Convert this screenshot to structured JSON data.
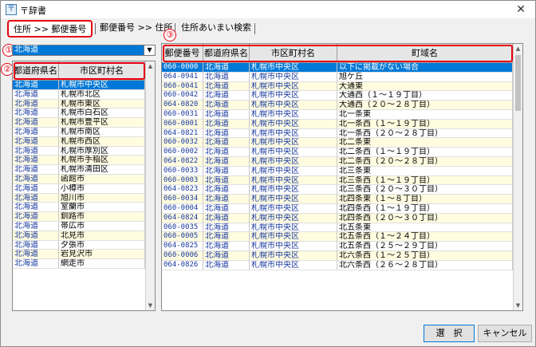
{
  "window": {
    "title": "〒辞書",
    "close_glyph": "✕",
    "icon_glyph": "〒"
  },
  "tabs": [
    {
      "label": "住所 >> 郵便番号"
    },
    {
      "label": "郵便番号 >> 住所"
    },
    {
      "label": "住所あいまい検索"
    }
  ],
  "markers": [
    "①",
    "②",
    "③"
  ],
  "prefecture_select": {
    "value": "北海道",
    "drop_glyph": "▼"
  },
  "left_list": {
    "headers": [
      "都道府県名",
      "市区町村名"
    ],
    "rows": [
      [
        "北海道",
        "札幌市中央区"
      ],
      [
        "北海道",
        "札幌市北区"
      ],
      [
        "北海道",
        "札幌市東区"
      ],
      [
        "北海道",
        "札幌市白石区"
      ],
      [
        "北海道",
        "札幌市豊平区"
      ],
      [
        "北海道",
        "札幌市南区"
      ],
      [
        "北海道",
        "札幌市西区"
      ],
      [
        "北海道",
        "札幌市厚別区"
      ],
      [
        "北海道",
        "札幌市手稲区"
      ],
      [
        "北海道",
        "札幌市清田区"
      ],
      [
        "北海道",
        "函館市"
      ],
      [
        "北海道",
        "小樽市"
      ],
      [
        "北海道",
        "旭川市"
      ],
      [
        "北海道",
        "室蘭市"
      ],
      [
        "北海道",
        "釧路市"
      ],
      [
        "北海道",
        "帯広市"
      ],
      [
        "北海道",
        "北見市"
      ],
      [
        "北海道",
        "夕張市"
      ],
      [
        "北海道",
        "岩見沢市"
      ],
      [
        "北海道",
        "網走市"
      ]
    ]
  },
  "right_list": {
    "headers": [
      "郵便番号",
      "都道府県名",
      "市区町村名",
      "町域名"
    ],
    "rows": [
      [
        "060-0000",
        "北海道",
        "札幌市中央区",
        "以下に掲載がない場合"
      ],
      [
        "064-0941",
        "北海道",
        "札幌市中央区",
        "旭ケ丘"
      ],
      [
        "060-0041",
        "北海道",
        "札幌市中央区",
        "大通東"
      ],
      [
        "060-0042",
        "北海道",
        "札幌市中央区",
        "大通西（１〜１９丁目）"
      ],
      [
        "064-0820",
        "北海道",
        "札幌市中央区",
        "大通西（２０〜２８丁目）"
      ],
      [
        "060-0031",
        "北海道",
        "札幌市中央区",
        "北一条東"
      ],
      [
        "060-0001",
        "北海道",
        "札幌市中央区",
        "北一条西（１〜１９丁目）"
      ],
      [
        "064-0821",
        "北海道",
        "札幌市中央区",
        "北一条西（２０〜２８丁目）"
      ],
      [
        "060-0032",
        "北海道",
        "札幌市中央区",
        "北二条東"
      ],
      [
        "060-0002",
        "北海道",
        "札幌市中央区",
        "北二条西（１〜１９丁目）"
      ],
      [
        "064-0822",
        "北海道",
        "札幌市中央区",
        "北二条西（２０〜２８丁目）"
      ],
      [
        "060-0033",
        "北海道",
        "札幌市中央区",
        "北三条東"
      ],
      [
        "060-0003",
        "北海道",
        "札幌市中央区",
        "北三条西（１〜１９丁目）"
      ],
      [
        "064-0823",
        "北海道",
        "札幌市中央区",
        "北三条西（２０〜３０丁目）"
      ],
      [
        "060-0034",
        "北海道",
        "札幌市中央区",
        "北四条東（１〜８丁目）"
      ],
      [
        "060-0004",
        "北海道",
        "札幌市中央区",
        "北四条西（１〜１９丁目）"
      ],
      [
        "064-0824",
        "北海道",
        "札幌市中央区",
        "北四条西（２０〜３０丁目）"
      ],
      [
        "060-0035",
        "北海道",
        "札幌市中央区",
        "北五条東"
      ],
      [
        "060-0005",
        "北海道",
        "札幌市中央区",
        "北五条西（１〜２４丁目）"
      ],
      [
        "064-0825",
        "北海道",
        "札幌市中央区",
        "北五条西（２５〜２９丁目）"
      ],
      [
        "060-0006",
        "北海道",
        "札幌市中央区",
        "北六条西（１〜２５丁目）"
      ],
      [
        "064-0826",
        "北海道",
        "札幌市中央区",
        "北六条西（２６〜２８丁目）"
      ]
    ]
  },
  "scroll_glyphs": {
    "up": "▲",
    "down": "▼"
  },
  "buttons": {
    "select": "選　択",
    "cancel": "キャンセル"
  }
}
